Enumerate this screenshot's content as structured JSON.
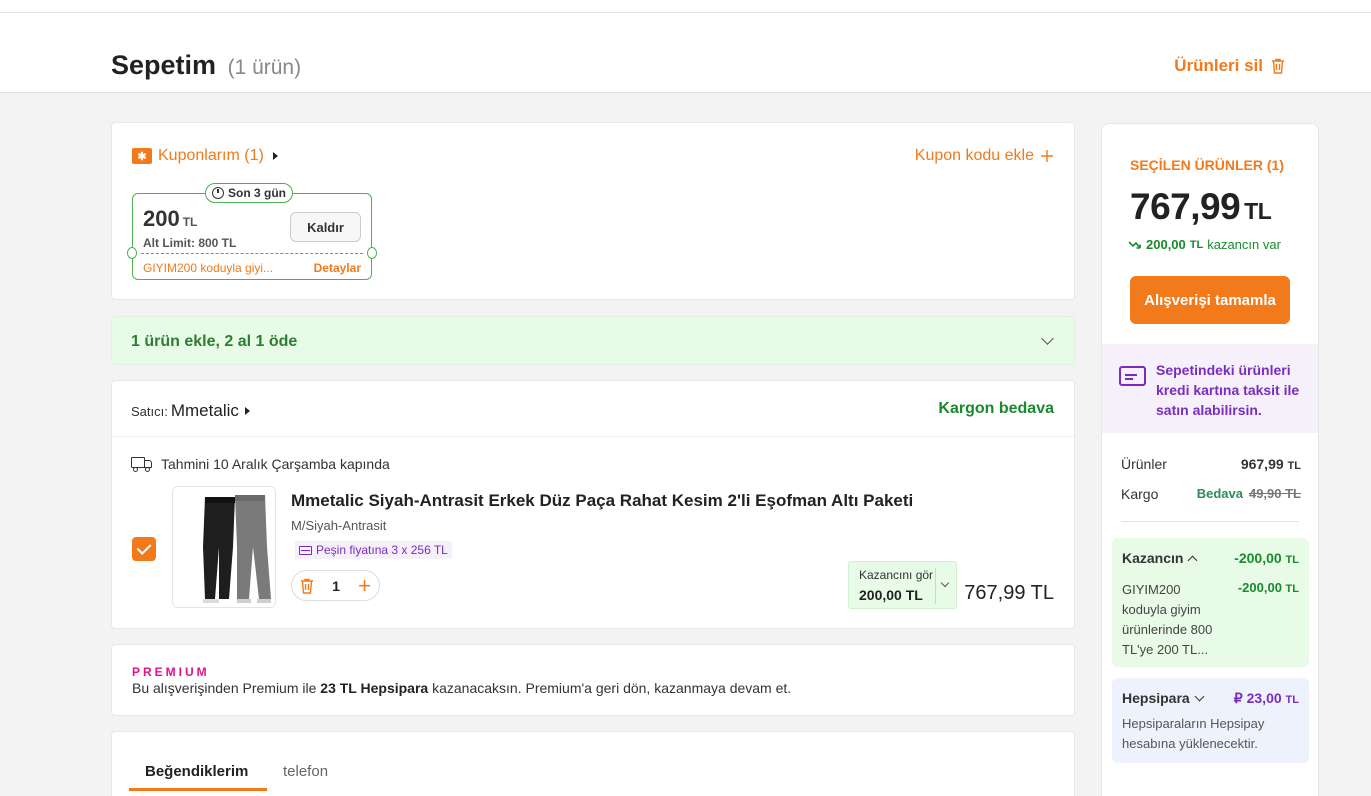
{
  "header": {
    "title": "Sepetim",
    "count": "(1 ürün)",
    "delete_all": "Ürünleri sil"
  },
  "coupons": {
    "link_label": "Kuponlarım (1)",
    "add_code": "Kupon kodu ekle",
    "ticket": {
      "badge": "Son 3 gün",
      "amount": "200",
      "currency": "TL",
      "limit": "Alt Limit: 800 TL",
      "remove_label": "Kaldır",
      "description": "GIYIM200 koduyla giyi...",
      "details_label": "Detaylar"
    }
  },
  "promo": {
    "text": "1 ürün ekle, 2 al 1 öde"
  },
  "seller": {
    "label": "Satıcı:",
    "name": "Mmetalic",
    "shipping": "Kargon bedava",
    "delivery": "Tahmini 10 Aralık Çarşamba kapında"
  },
  "item": {
    "title": "Mmetalic Siyah-Antrasit Erkek Düz Paça Rahat Kesim 2'li Eşofman Altı Paketi",
    "variant": "M/Siyah-Antrasit",
    "installment": "Peşin fiyatına 3 x 256 TL",
    "quantity": "1",
    "savings_label": "Kazancını gör",
    "savings_value": "200,00 TL",
    "price": "767,99 TL"
  },
  "premium": {
    "logo": "PREMIUM",
    "text_before": "Bu alışverişinden Premium ile ",
    "text_bold": "23 TL Hepsipara",
    "text_after": " kazanacaksın. Premium'a geri dön, kazanmaya devam et."
  },
  "tabs": [
    "Beğendiklerim",
    "telefon"
  ],
  "summary": {
    "heading": "SEÇİLEN ÜRÜNLER (1)",
    "total": "767,99",
    "currency": "TL",
    "gain_amount": "200,00",
    "gain_currency": "TL",
    "gain_text": "kazancın var",
    "checkout": "Alışverişi tamamla",
    "installment_text": "Sepetindeki ürünleri kredi kartına taksit ile satın alabilirsin.",
    "products_label": "Ürünler",
    "products_value": "967,99",
    "cargo_label": "Kargo",
    "cargo_free": "Bedava",
    "cargo_old": "49,90 TL",
    "discount_label": "Kazancın",
    "discount_total": "-200,00",
    "discount_item_text": "GIYIM200 koduyla giyim ürünlerinde 800 TL'ye 200 TL...",
    "discount_item_value": "-200,00",
    "hepsipara_label": "Hepsipara",
    "hepsipara_value": "23,00",
    "hepsipara_desc": "Hepsiparaların Hepsipay hesabına yüklenecektir."
  },
  "colors": {
    "accent": "#f27a1a",
    "success": "#1b8a2e",
    "purple": "#7b2cbf",
    "premium": "#e0138c"
  }
}
